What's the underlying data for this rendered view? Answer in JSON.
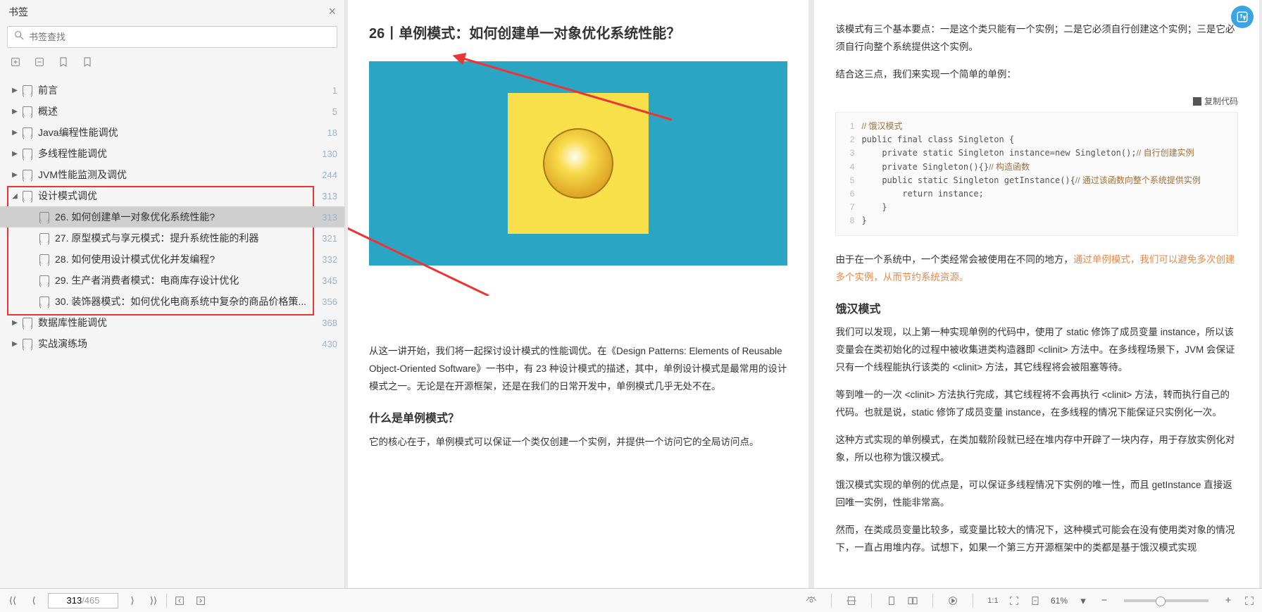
{
  "sidebar": {
    "title": "书签",
    "search_placeholder": "书签查找",
    "items": [
      {
        "label": "前言",
        "page": "1",
        "level": 0,
        "arrow": "▶",
        "sel": false
      },
      {
        "label": "概述",
        "page": "5",
        "level": 0,
        "arrow": "▶",
        "sel": false
      },
      {
        "label": "Java编程性能调优",
        "page": "18",
        "level": 0,
        "arrow": "▶",
        "sel": false
      },
      {
        "label": "多线程性能调优",
        "page": "130",
        "level": 0,
        "arrow": "▶",
        "sel": false
      },
      {
        "label": "JVM性能监测及调优",
        "page": "244",
        "level": 0,
        "arrow": "▶",
        "sel": false
      },
      {
        "label": "设计模式调优",
        "page": "313",
        "level": 0,
        "arrow": "◢",
        "sel": false
      },
      {
        "label": "26. 如何创建单一对象优化系统性能?",
        "page": "313",
        "level": 1,
        "arrow": "",
        "sel": true
      },
      {
        "label": "27. 原型模式与享元模式：提升系统性能的利器",
        "page": "321",
        "level": 1,
        "arrow": "",
        "sel": false
      },
      {
        "label": "28. 如何使用设计模式优化并发编程?",
        "page": "332",
        "level": 1,
        "arrow": "",
        "sel": false
      },
      {
        "label": "29. 生产者消费者模式：电商库存设计优化",
        "page": "345",
        "level": 1,
        "arrow": "",
        "sel": false
      },
      {
        "label": "30. 装饰器模式：如何优化电商系统中复杂的商品价格策...",
        "page": "356",
        "level": 1,
        "arrow": "",
        "sel": false
      },
      {
        "label": "数据库性能调优",
        "page": "368",
        "level": 0,
        "arrow": "▶",
        "sel": false
      },
      {
        "label": "实战演练场",
        "page": "430",
        "level": 0,
        "arrow": "▶",
        "sel": false
      }
    ]
  },
  "left_page": {
    "title": "26丨单例模式：如何创建单一对象优化系统性能？",
    "p1": "从这一讲开始，我们将一起探讨设计模式的性能调优。在《Design Patterns: Elements of Reusable Object-Oriented Software》一书中，有 23 种设计模式的描述，其中，单例设计模式是最常用的设计模式之一。无论是在开源框架，还是在我们的日常开发中，单例模式几乎无处不在。",
    "h2": "什么是单例模式？",
    "p2": "它的核心在于，单例模式可以保证一个类仅创建一个实例，并提供一个访问它的全局访问点。"
  },
  "right_page": {
    "p1": "该模式有三个基本要点：一是这个类只能有一个实例；二是它必须自行创建这个实例；三是它必须自行向整个系统提供这个实例。",
    "p2": "结合这三点，我们来实现一个简单的单例：",
    "copy_label": "复制代码",
    "code_lines": [
      "// 饿汉模式",
      "public final class Singleton {",
      "    private static Singleton instance=new Singleton();// 自行创建实例",
      "    private Singleton(){}// 构造函数",
      "    public static Singleton getInstance(){// 通过该函数向整个系统提供实例",
      "        return instance;",
      "    }",
      "}"
    ],
    "p3a": "由于在一个系统中，一个类经常会被使用在不同的地方，",
    "p3b": "通过单例模式，我们可以避免多次创建多个实例，从而节约系统资源。",
    "h2": "饿汉模式",
    "p4": "我们可以发现，以上第一种实现单例的代码中，使用了 static 修饰了成员变量 instance，所以该变量会在类初始化的过程中被收集进类构造器即 <clinit> 方法中。在多线程场景下，JVM 会保证只有一个线程能执行该类的 <clinit> 方法，其它线程将会被阻塞等待。",
    "p5": "等到唯一的一次 <clinit> 方法执行完成，其它线程将不会再执行 <clinit> 方法，转而执行自己的代码。也就是说，static 修饰了成员变量 instance，在多线程的情况下能保证只实例化一次。",
    "p6": "这种方式实现的单例模式，在类加载阶段就已经在堆内存中开辟了一块内存，用于存放实例化对象，所以也称为饿汉模式。",
    "p7": "饿汉模式实现的单例的优点是，可以保证多线程情况下实例的唯一性，而且 getInstance 直接返回唯一实例，性能非常高。",
    "p8": "然而，在类成员变量比较多，或变量比较大的情况下，这种模式可能会在没有使用类对象的情况下，一直占用堆内存。试想下，如果一个第三方开源框架中的类都是基于饿汉模式实现"
  },
  "footer": {
    "page_current": "313",
    "page_total": "/465",
    "zoom_label": "61%",
    "ratio_label": "1:1"
  }
}
